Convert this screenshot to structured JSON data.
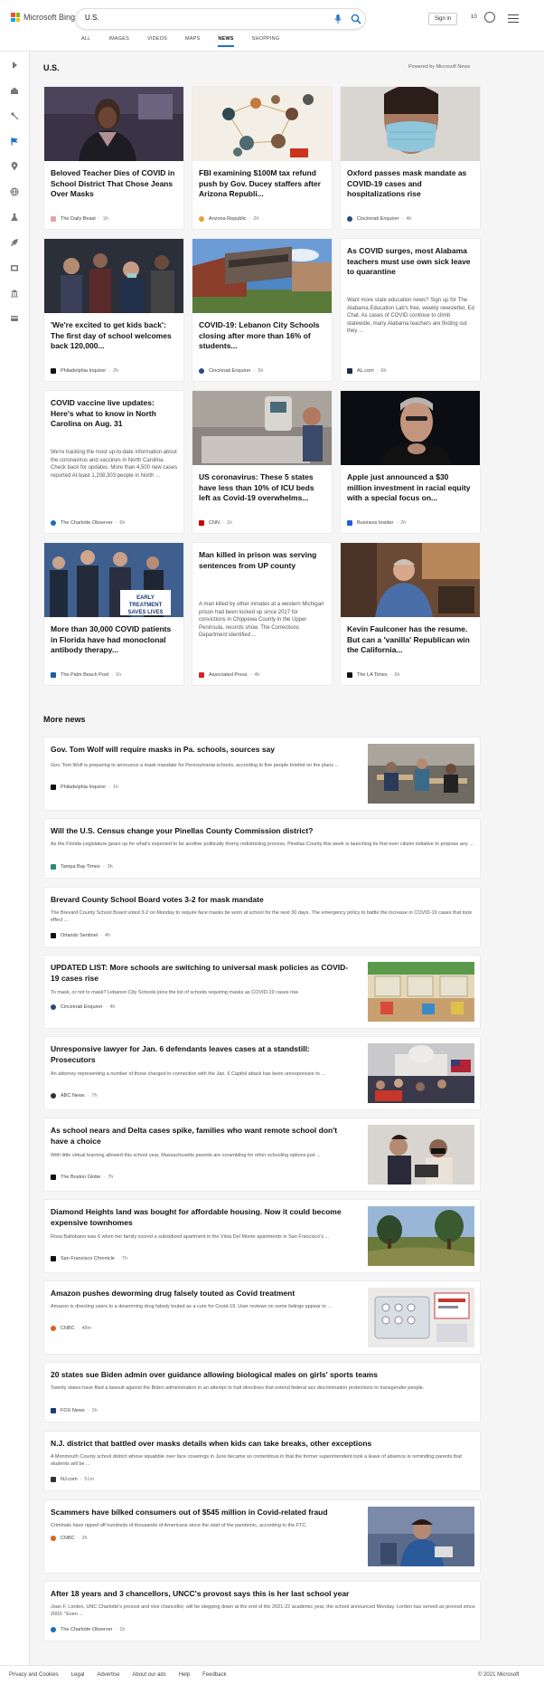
{
  "header": {
    "logo_text": "Microsoft Bing",
    "search_value": "U.S.",
    "signin_label": "Sign in",
    "rewards_count": "10",
    "nav": [
      "ALL",
      "IMAGES",
      "VIDEOS",
      "MAPS",
      "NEWS",
      "SHOPPING"
    ],
    "active_nav": "NEWS"
  },
  "section": {
    "title": "U.S.",
    "powered_by": "Powered by Microsoft News"
  },
  "cards": [
    {
      "title": "Beloved Teacher Dies of COVID in School District That Chose Jeans Over Masks",
      "summary": "",
      "source": "The Daily Beast",
      "time": "1h",
      "fav_color": "#e8a0a8",
      "has_image": true
    },
    {
      "title": "FBI examining $100M tax refund push by Gov. Ducey staffers after Arizona Republi...",
      "summary": "",
      "source": "Arizona Republic",
      "time": "2h",
      "fav_color": "#e8a030",
      "has_image": true
    },
    {
      "title": "Oxford passes mask mandate as COVID-19 cases and hospitalizations rise",
      "summary": "",
      "source": "Cincinnati Enquirer",
      "time": "4h",
      "fav_color": "#2a4a80",
      "has_image": true
    },
    {
      "title": "'We're excited to get kids back': The first day of school welcomes back 120,000...",
      "summary": "",
      "source": "Philadelphia Inquirer",
      "time": "2h",
      "fav_color": "#111111",
      "has_image": true
    },
    {
      "title": "COVID-19: Lebanon City Schools closing after more than 16% of students...",
      "summary": "",
      "source": "Cincinnati Enquirer",
      "time": "5h",
      "fav_color": "#2a4a80",
      "has_image": true
    },
    {
      "title": "As COVID surges, most Alabama teachers must use own sick leave to quarantine",
      "summary": "Want more state education news? Sign up for The Alabama Education Lab's free, weekly newsletter, Ed Chat. As cases of COVID continue to climb statewide, many Alabama teachers are finding out they ...",
      "source": "AL.com",
      "time": "6h",
      "fav_color": "#1d2b4a",
      "has_image": false
    },
    {
      "title": "COVID vaccine live updates: Here's what to know in North Carolina on Aug. 31",
      "summary": "We're tracking the most up-to-date information about the coronavirus and vaccines in North Carolina. Check back for updates. More than 4,500 new cases reported At least 1,208,303 people in North ...",
      "source": "The Charlotte Observer",
      "time": "6h",
      "fav_color": "#1b6fb5",
      "has_image": false
    },
    {
      "title": "US coronavirus: These 5 states have less than 10% of ICU beds left as Covid-19 overwhelms...",
      "summary": "",
      "source": "CNN",
      "time": "1h",
      "fav_color": "#cc0000",
      "has_image": true
    },
    {
      "title": "Apple just announced a $30 million investment in racial equity with a special focus on...",
      "summary": "",
      "source": "Business Insider",
      "time": "2h",
      "fav_color": "#1f5fe0",
      "has_image": true
    },
    {
      "title": "More than 30,000 COVID patients in Florida have had monoclonal antibody therapy...",
      "summary": "",
      "source": "The Palm Beach Post",
      "time": "1h",
      "fav_color": "#1560a8",
      "has_image": true
    },
    {
      "title": "Man killed in prison was serving sentences from UP county",
      "summary": "A man killed by other inmates at a western Michigan prison had been locked up since 2017 for convictions in Chippewa County in the Upper Peninsula, records show. The Corrections Department identified ...",
      "source": "Associated Press",
      "time": "4h",
      "fav_color": "#d6232a",
      "has_image": false
    },
    {
      "title": "Kevin Faulconer has the resume. But can a 'vanilla' Republican win the California...",
      "summary": "",
      "source": "The LA Times",
      "time": "6h",
      "fav_color": "#111111",
      "has_image": true
    }
  ],
  "more_news": {
    "title": "More news",
    "items": [
      {
        "title": "Gov. Tom Wolf will require masks in Pa. schools, sources say",
        "summary": "Gov. Tom Wolf is preparing to announce a mask mandate for Pennsylvania schools, according to five people briefed on the plans ...",
        "source": "Philadelphia Inquirer",
        "time": "1h",
        "fav_color": "#111111",
        "has_image": true
      },
      {
        "title": "Will the U.S. Census change your Pinellas County Commission district?",
        "summary": "As the Florida Legislature gears up for what's expected to be another politically thorny redistricting process, Pinellas County this week is launching its first-ever citizen initiative to propose any ...",
        "source": "Tampa Bay Times",
        "time": "3h",
        "fav_color": "#2a8a7a",
        "has_image": false
      },
      {
        "title": "Brevard County School Board votes 3-2 for mask mandate",
        "summary": "The Brevard County School Board voted 3-2 on Monday to require face masks be worn at school for the next 30 days. The emergency policy to battle the increase in COVID-19 cases that took effect ...",
        "source": "Orlando Sentinel",
        "time": "4h",
        "fav_color": "#111111",
        "has_image": false
      },
      {
        "title": "UPDATED LIST: More schools are switching to universal mask policies as COVID-19 cases rise",
        "summary": "To mask, or not to mask? Lebanon City Schools joins the list of schools requiring masks as COVID-19 cases rise.",
        "source": "Cincinnati Enquirer",
        "time": "4h",
        "fav_color": "#2a4a80",
        "has_image": true
      },
      {
        "title": "Unresponsive lawyer for Jan. 6 defendants leaves cases at a standstill: Prosecutors",
        "summary": "An attorney representing a number of those charged in connection with the Jan. 6 Capitol attack has been unresponsive to ...",
        "source": "ABC News",
        "time": "7h",
        "fav_color": "#333333",
        "has_image": true
      },
      {
        "title": "As school nears and Delta cases spike, families who want remote school don't have a choice",
        "summary": "With little virtual learning allowed this school year, Massachusetts parents are scrambling for other schooling options just ...",
        "source": "The Boston Globe",
        "time": "7h",
        "fav_color": "#111111",
        "has_image": true
      },
      {
        "title": "Diamond Heights land was bought for affordable housing. Now it could become expensive townhomes",
        "summary": "Rosa Baltobano was 6 when her family scored a subsidized apartment in the Vista Del Monte apartments in San Francisco's ...",
        "source": "San Francisco Chronicle",
        "time": "7h",
        "fav_color": "#111111",
        "has_image": true
      },
      {
        "title": "Amazon pushes deworming drug falsely touted as Covid treatment",
        "summary": "Amazon is directing users to a deworming drug falsely touted as a cure for Covid-19. User reviews on some listings appear to ...",
        "source": "CNBC",
        "time": "48m",
        "fav_color": "#e06020",
        "has_image": true
      },
      {
        "title": "20 states sue Biden admin over guidance allowing biological males on girls' sports teams",
        "summary": "Twenty states have filed a lawsuit against the Biden administration in an attempt to halt directives that extend federal sex discrimination protections to transgender people.",
        "source": "FOX News",
        "time": "1h",
        "fav_color": "#1a3a7a",
        "has_image": false
      },
      {
        "title": "N.J. district that battled over masks details when kids can take breaks, other exceptions",
        "summary": "A Monmouth County school district whose squabble over face coverings in June became so contentious in that the former superintendent took a leave of absence is reminding parents that students will be ...",
        "source": "NJ.com",
        "time": "51m",
        "fav_color": "#333333",
        "has_image": false
      },
      {
        "title": "Scammers have bilked consumers out of $545 million in Covid-related fraud",
        "summary": "Criminals have ripped off hundreds of thousands of Americans since the start of the pandemic, according to the FTC.",
        "source": "CNBC",
        "time": "2h",
        "fav_color": "#e06020",
        "has_image": true
      },
      {
        "title": "After 18 years and 3 chancellors, UNCC's provost says this is her last school year",
        "summary": "Joan F. Lorden, UNC Charlotte's provost and vice chancellor, will be stepping down at the end of the 2021-22 academic year, the school announced Monday. Lorden has served as provost since 2003. \"Even ...",
        "source": "The Charlotte Observer",
        "time": "1h",
        "fav_color": "#1b6fb5",
        "has_image": false
      }
    ]
  },
  "footer": {
    "links": [
      "Privacy and Cookies",
      "Legal",
      "Advertise",
      "About our ads",
      "Help",
      "Feedback"
    ],
    "copyright": "© 2021 Microsoft"
  },
  "colors": {
    "accent": "#1a73c8",
    "background": "#f5f5f5"
  },
  "sidebar_icons": [
    "arrow-right-icon",
    "home-icon",
    "sports-icon",
    "flag-icon",
    "location-icon",
    "globe-icon",
    "science-icon",
    "rocket-icon",
    "entertainment-icon",
    "money-icon",
    "card-icon"
  ]
}
